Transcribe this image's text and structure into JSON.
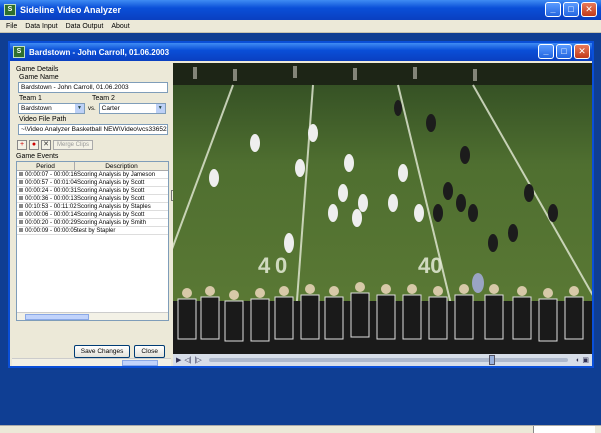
{
  "app": {
    "title": "Sideline Video Analyzer",
    "menu": [
      "File",
      "Data Input",
      "Data Output",
      "About"
    ]
  },
  "window": {
    "title": "Bardstown - John Carroll, 01.06.2003"
  },
  "game_details": {
    "section": "Game Details",
    "game_name_label": "Game Name",
    "game_name": "Bardstown - John Carroll, 01.06.2003",
    "team1_label": "Team 1",
    "team1": "Bardstown",
    "vs": "vs.",
    "team2_label": "Team 2",
    "team2": "Carter",
    "video_path_label": "Video File Path",
    "video_path": "~\\Video Analyzer Basketball NEW\\Video\\vcs336523"
  },
  "toolbar": {
    "merge_label": "Merge Clips"
  },
  "events": {
    "section": "Game Events",
    "col_period": "Period",
    "col_description": "Description",
    "rows": [
      {
        "period": "00:00:07 - 00:00:16",
        "description": "Scoring Analysis by Jameson"
      },
      {
        "period": "00:00:57 - 00:01:04",
        "description": "Scoring Analysis by Scott"
      },
      {
        "period": "00:00:24 - 00:00:31",
        "description": "Scoring Analysis by Scott"
      },
      {
        "period": "00:00:36 - 00:00:13",
        "description": "Scoring Analysis by Scott"
      },
      {
        "period": "00:10:53 - 00:11:02",
        "description": "Scoring Analysis by Staples"
      },
      {
        "period": "00:00:06 - 00:00:14",
        "description": "Scoring Analysis by Scott"
      },
      {
        "period": "00:00:20 - 00:00:29",
        "description": "Scoring Analysis by Smith"
      },
      {
        "period": "00:00:09 - 00:00:05",
        "description": "test by Stapler"
      }
    ]
  },
  "buttons": {
    "save": "Save Changes",
    "close": "Close"
  },
  "video": {
    "yard_numbers": [
      "4",
      "0",
      "40"
    ],
    "playback_progress": 0.78
  }
}
